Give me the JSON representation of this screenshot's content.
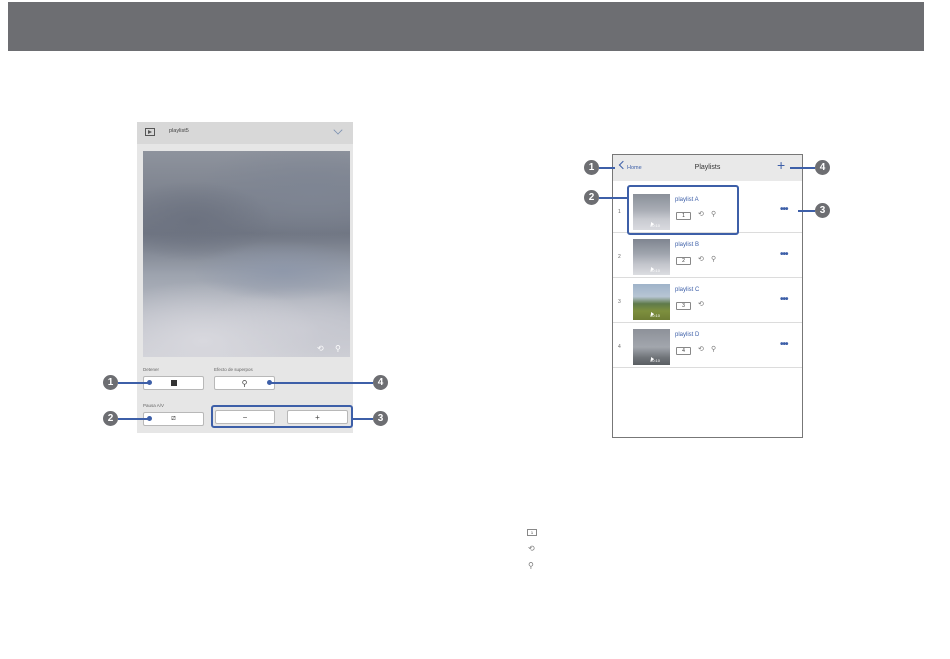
{
  "left_panel": {
    "title": "playlist5",
    "labels": {
      "stop": "Detener",
      "effects": "Efecto de superpos",
      "av_mute": "Pausa A/V"
    },
    "buttons": {
      "minus": "−",
      "plus": "+"
    },
    "icons": [
      "play-icon",
      "chevron-down-icon",
      "repeat-icon",
      "effect-wand-icon",
      "stop-icon",
      "av-mute-icon"
    ]
  },
  "callouts": {
    "c1": "1",
    "c2": "2",
    "c3": "3",
    "c4": "4",
    "d1": "1",
    "d2": "2",
    "d3": "3",
    "d4": "4"
  },
  "right_panel": {
    "back_label": "Home",
    "title": "Playlists",
    "add": "+",
    "playlists": [
      {
        "index": "1",
        "name": "playlist A",
        "number": "1",
        "duration": "00:10",
        "repeat": true,
        "effect": true
      },
      {
        "index": "2",
        "name": "playlist B",
        "number": "2",
        "duration": "00:10",
        "repeat": true,
        "effect": true
      },
      {
        "index": "3",
        "name": "playlist C",
        "number": "3",
        "duration": "00:10",
        "repeat": true,
        "effect": false
      },
      {
        "index": "4",
        "name": "playlist D",
        "number": "4",
        "duration": "00:10",
        "repeat": true,
        "effect": true
      }
    ],
    "more": "•••"
  },
  "legend": {
    "badge": "1",
    "icons": [
      "number-badge-icon",
      "repeat-icon",
      "effect-wand-icon"
    ]
  },
  "colors": {
    "accent": "#3d5fa8",
    "top_bar": "#6d6e72",
    "callout": "#6d6e72"
  }
}
